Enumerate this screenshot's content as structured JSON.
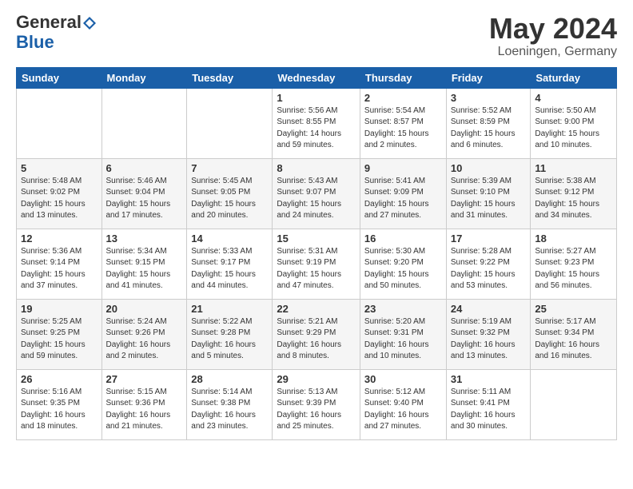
{
  "header": {
    "logo_line1": "General",
    "logo_line2": "Blue",
    "month": "May 2024",
    "location": "Loeningen, Germany"
  },
  "weekdays": [
    "Sunday",
    "Monday",
    "Tuesday",
    "Wednesday",
    "Thursday",
    "Friday",
    "Saturday"
  ],
  "weeks": [
    [
      {
        "day": "",
        "info": ""
      },
      {
        "day": "",
        "info": ""
      },
      {
        "day": "",
        "info": ""
      },
      {
        "day": "1",
        "info": "Sunrise: 5:56 AM\nSunset: 8:55 PM\nDaylight: 14 hours\nand 59 minutes."
      },
      {
        "day": "2",
        "info": "Sunrise: 5:54 AM\nSunset: 8:57 PM\nDaylight: 15 hours\nand 2 minutes."
      },
      {
        "day": "3",
        "info": "Sunrise: 5:52 AM\nSunset: 8:59 PM\nDaylight: 15 hours\nand 6 minutes."
      },
      {
        "day": "4",
        "info": "Sunrise: 5:50 AM\nSunset: 9:00 PM\nDaylight: 15 hours\nand 10 minutes."
      }
    ],
    [
      {
        "day": "5",
        "info": "Sunrise: 5:48 AM\nSunset: 9:02 PM\nDaylight: 15 hours\nand 13 minutes."
      },
      {
        "day": "6",
        "info": "Sunrise: 5:46 AM\nSunset: 9:04 PM\nDaylight: 15 hours\nand 17 minutes."
      },
      {
        "day": "7",
        "info": "Sunrise: 5:45 AM\nSunset: 9:05 PM\nDaylight: 15 hours\nand 20 minutes."
      },
      {
        "day": "8",
        "info": "Sunrise: 5:43 AM\nSunset: 9:07 PM\nDaylight: 15 hours\nand 24 minutes."
      },
      {
        "day": "9",
        "info": "Sunrise: 5:41 AM\nSunset: 9:09 PM\nDaylight: 15 hours\nand 27 minutes."
      },
      {
        "day": "10",
        "info": "Sunrise: 5:39 AM\nSunset: 9:10 PM\nDaylight: 15 hours\nand 31 minutes."
      },
      {
        "day": "11",
        "info": "Sunrise: 5:38 AM\nSunset: 9:12 PM\nDaylight: 15 hours\nand 34 minutes."
      }
    ],
    [
      {
        "day": "12",
        "info": "Sunrise: 5:36 AM\nSunset: 9:14 PM\nDaylight: 15 hours\nand 37 minutes."
      },
      {
        "day": "13",
        "info": "Sunrise: 5:34 AM\nSunset: 9:15 PM\nDaylight: 15 hours\nand 41 minutes."
      },
      {
        "day": "14",
        "info": "Sunrise: 5:33 AM\nSunset: 9:17 PM\nDaylight: 15 hours\nand 44 minutes."
      },
      {
        "day": "15",
        "info": "Sunrise: 5:31 AM\nSunset: 9:19 PM\nDaylight: 15 hours\nand 47 minutes."
      },
      {
        "day": "16",
        "info": "Sunrise: 5:30 AM\nSunset: 9:20 PM\nDaylight: 15 hours\nand 50 minutes."
      },
      {
        "day": "17",
        "info": "Sunrise: 5:28 AM\nSunset: 9:22 PM\nDaylight: 15 hours\nand 53 minutes."
      },
      {
        "day": "18",
        "info": "Sunrise: 5:27 AM\nSunset: 9:23 PM\nDaylight: 15 hours\nand 56 minutes."
      }
    ],
    [
      {
        "day": "19",
        "info": "Sunrise: 5:25 AM\nSunset: 9:25 PM\nDaylight: 15 hours\nand 59 minutes."
      },
      {
        "day": "20",
        "info": "Sunrise: 5:24 AM\nSunset: 9:26 PM\nDaylight: 16 hours\nand 2 minutes."
      },
      {
        "day": "21",
        "info": "Sunrise: 5:22 AM\nSunset: 9:28 PM\nDaylight: 16 hours\nand 5 minutes."
      },
      {
        "day": "22",
        "info": "Sunrise: 5:21 AM\nSunset: 9:29 PM\nDaylight: 16 hours\nand 8 minutes."
      },
      {
        "day": "23",
        "info": "Sunrise: 5:20 AM\nSunset: 9:31 PM\nDaylight: 16 hours\nand 10 minutes."
      },
      {
        "day": "24",
        "info": "Sunrise: 5:19 AM\nSunset: 9:32 PM\nDaylight: 16 hours\nand 13 minutes."
      },
      {
        "day": "25",
        "info": "Sunrise: 5:17 AM\nSunset: 9:34 PM\nDaylight: 16 hours\nand 16 minutes."
      }
    ],
    [
      {
        "day": "26",
        "info": "Sunrise: 5:16 AM\nSunset: 9:35 PM\nDaylight: 16 hours\nand 18 minutes."
      },
      {
        "day": "27",
        "info": "Sunrise: 5:15 AM\nSunset: 9:36 PM\nDaylight: 16 hours\nand 21 minutes."
      },
      {
        "day": "28",
        "info": "Sunrise: 5:14 AM\nSunset: 9:38 PM\nDaylight: 16 hours\nand 23 minutes."
      },
      {
        "day": "29",
        "info": "Sunrise: 5:13 AM\nSunset: 9:39 PM\nDaylight: 16 hours\nand 25 minutes."
      },
      {
        "day": "30",
        "info": "Sunrise: 5:12 AM\nSunset: 9:40 PM\nDaylight: 16 hours\nand 27 minutes."
      },
      {
        "day": "31",
        "info": "Sunrise: 5:11 AM\nSunset: 9:41 PM\nDaylight: 16 hours\nand 30 minutes."
      },
      {
        "day": "",
        "info": ""
      }
    ]
  ]
}
